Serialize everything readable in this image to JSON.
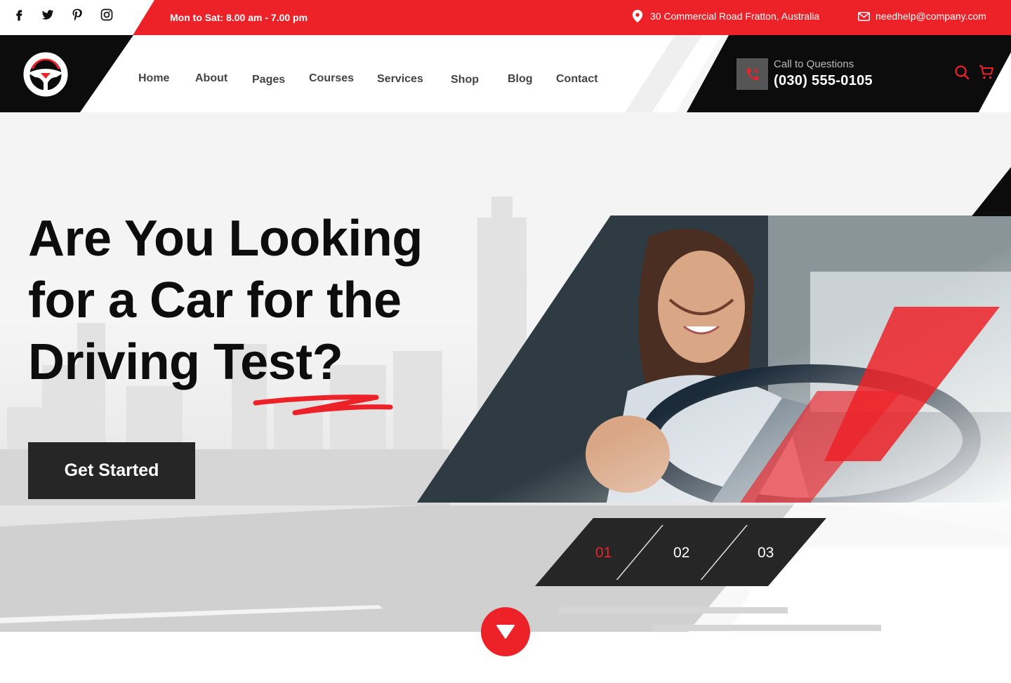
{
  "topbar": {
    "social": [
      {
        "name": "facebook-icon"
      },
      {
        "name": "twitter-icon"
      },
      {
        "name": "pinterest-icon"
      },
      {
        "name": "instagram-icon"
      }
    ],
    "hours": "Mon to Sat: 8.00 am - 7.00 pm",
    "address": "30 Commercial Road Fratton, Australia",
    "email": "needhelp@company.com"
  },
  "header": {
    "nav": [
      "Home",
      "About",
      "Pages",
      "Courses",
      "Services",
      "Shop",
      "Blog",
      "Contact"
    ],
    "call_label": "Call to Questions",
    "call_number": "(030) 555-0105"
  },
  "hero": {
    "headline": "Are You Looking for a Car for the Driving Test?",
    "cta": "Get Started",
    "slides": [
      "01",
      "02",
      "03"
    ],
    "active_slide": "01"
  },
  "colors": {
    "accent": "#ec2228",
    "dark": "#0c0c0c",
    "button": "#262626"
  }
}
